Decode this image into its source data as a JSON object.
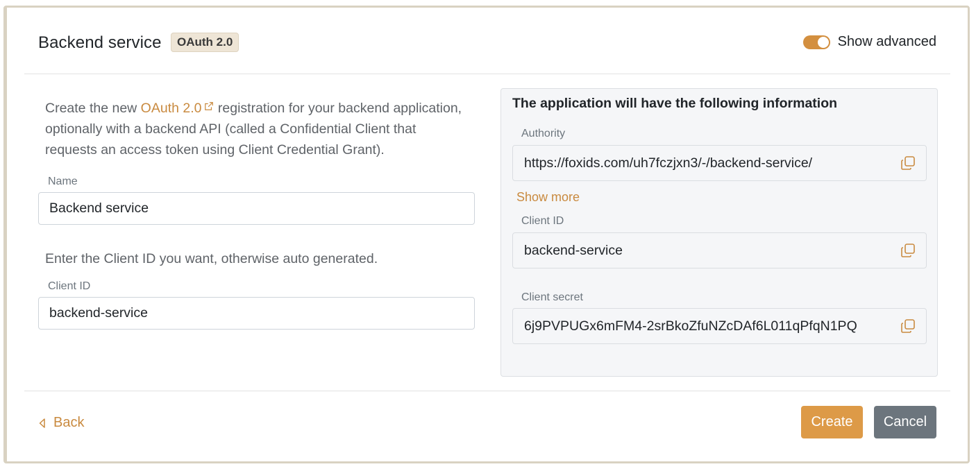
{
  "header": {
    "title": "Backend service",
    "badge": "OAuth 2.0",
    "toggle_label": "Show advanced",
    "toggle_on": true
  },
  "intro": {
    "before_link": "Create the new ",
    "link_text": "OAuth 2.0",
    "after_link": " registration for your backend application, optionally with a backend API (called a Confidential Client that requests an access token using Client Credential Grant)."
  },
  "form": {
    "name_label": "Name",
    "name_value": "Backend service",
    "client_id_hint": "Enter the Client ID you want, otherwise auto generated.",
    "client_id_label": "Client ID",
    "client_id_value": "backend-service"
  },
  "info_panel": {
    "title": "The application will have the following information",
    "authority_label": "Authority",
    "authority_value": "https://foxids.com/uh7fczjxn3/-/backend-service/",
    "show_more": "Show more",
    "client_id_label": "Client ID",
    "client_id_value": "backend-service",
    "client_secret_label": "Client secret",
    "client_secret_value": "6j9PVPUGx6mFM4-2srBkoZfuNZcDAf6L011qPfqN1PQ"
  },
  "footer": {
    "back_label": "Back",
    "create_label": "Create",
    "cancel_label": "Cancel"
  },
  "colors": {
    "accent": "#c98a3f",
    "create_button": "#dd9a47",
    "cancel_button": "#6c757d",
    "toggle": "#d38f3f"
  },
  "icons": {
    "external_link": "external-link-icon",
    "copy": "copy-icon",
    "back": "chevron-left-icon"
  }
}
